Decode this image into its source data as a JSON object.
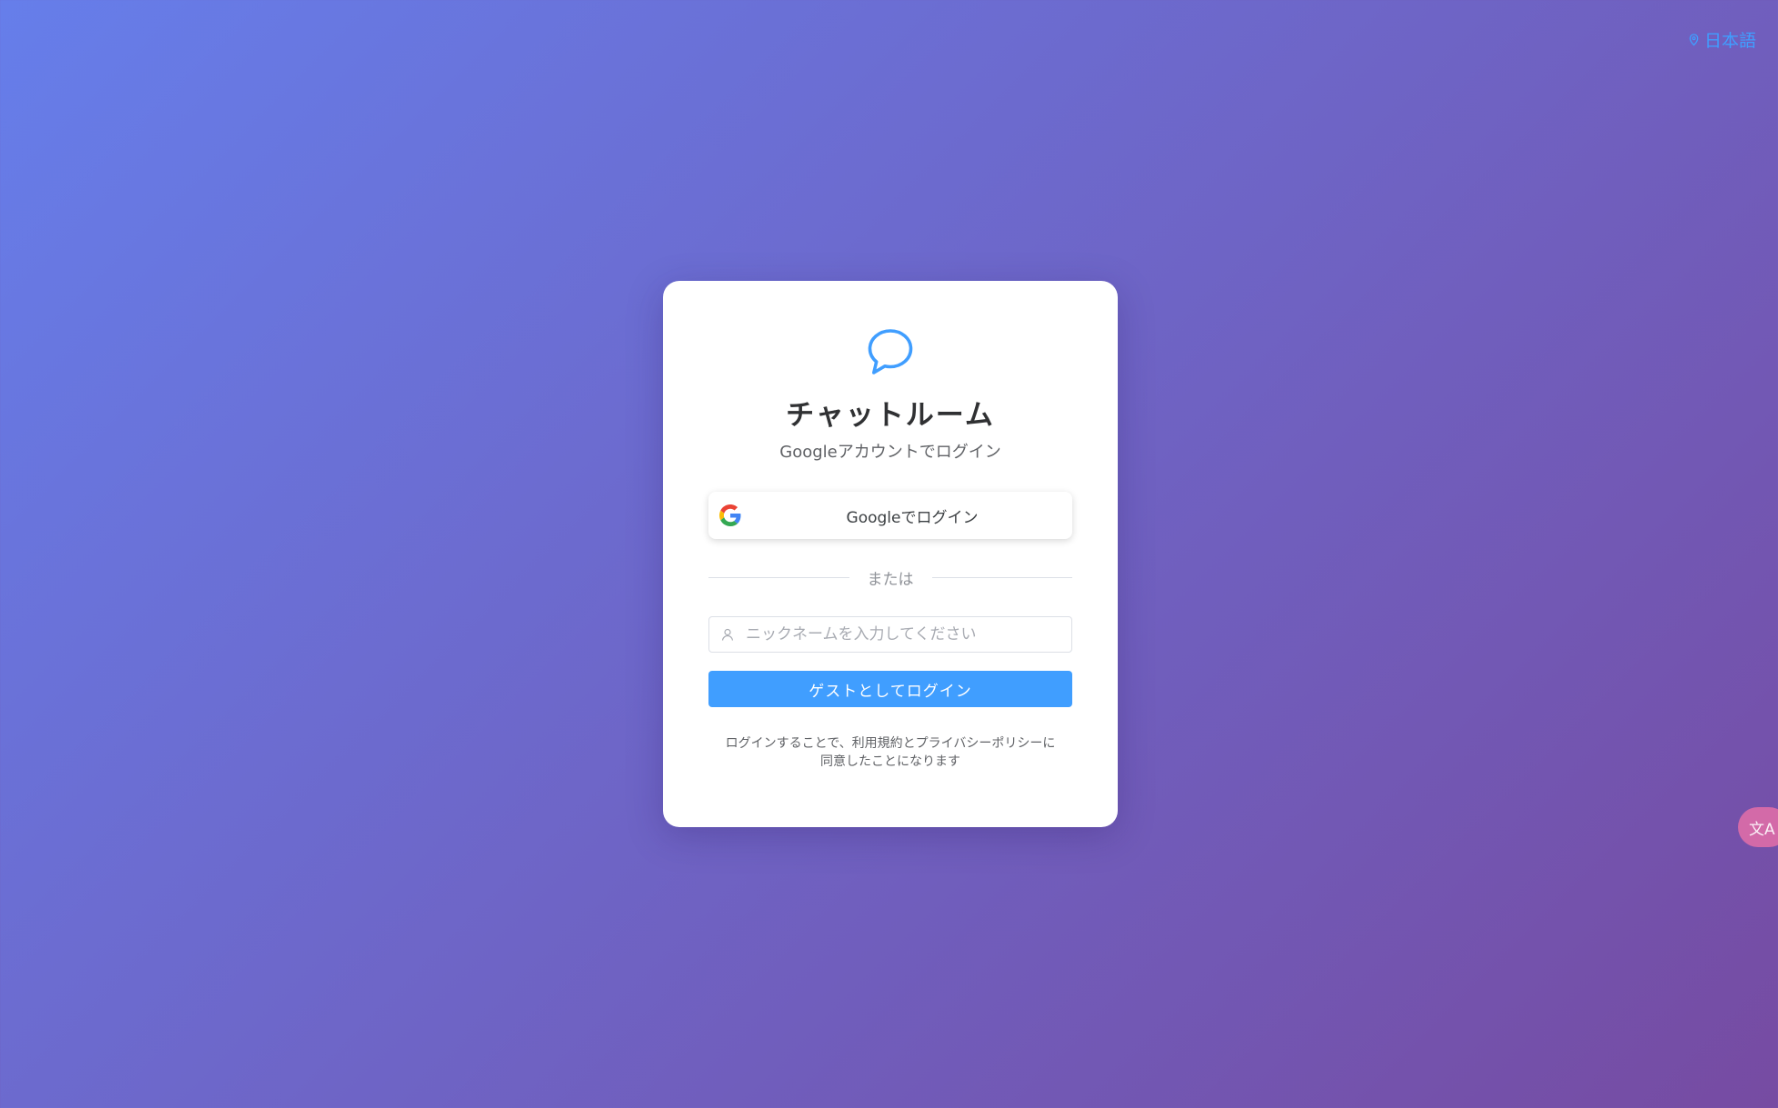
{
  "language": {
    "label": "日本語",
    "icon": "location-pin-icon"
  },
  "login": {
    "logo_icon": "chat-bubble-icon",
    "title": "チャットルーム",
    "subtitle": "Googleアカウントでログイン",
    "google_button_label": "Googleでログイン",
    "divider_text": "または",
    "nickname_placeholder": "ニックネームを入力してください",
    "nickname_value": "",
    "guest_button_label": "ゲストとしてログイン",
    "terms_line1": "ログインすることで、利用規約とプライバシーポリシーに",
    "terms_line2": "同意したことになります"
  },
  "translate_fab": {
    "icon": "translate-icon",
    "label": "文A"
  },
  "colors": {
    "gradient_start": "#667eea",
    "gradient_end": "#764ba2",
    "primary": "#409eff",
    "card_bg": "#ffffff",
    "fab": "#d36aa8"
  }
}
